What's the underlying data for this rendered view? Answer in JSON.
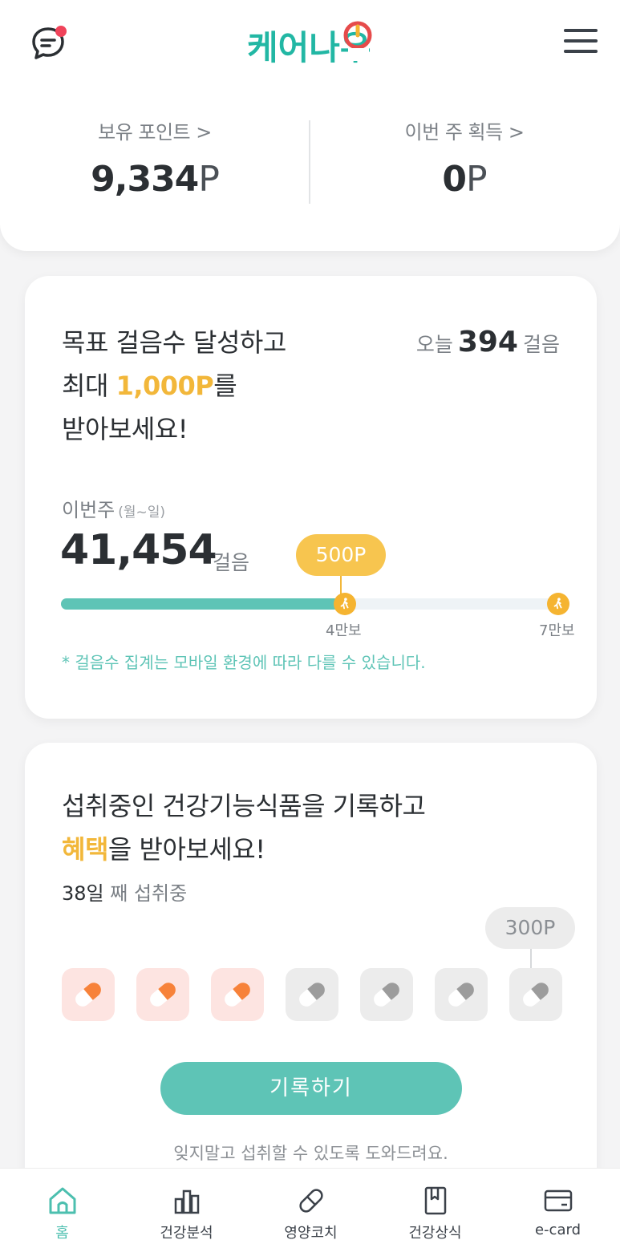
{
  "header": {
    "logo": "케어나우",
    "icons": {
      "chat": "chat-notification-icon",
      "menu": "hamburger-menu-icon"
    },
    "notification_dot_color": "#f0435a"
  },
  "points": {
    "held": {
      "label": "보유 포인트 >",
      "value": "9,334",
      "unit": "P"
    },
    "weekly": {
      "label": "이번 주 획득 >",
      "value": "0",
      "unit": "P"
    }
  },
  "steps_card": {
    "title_line1": "목표 걸음수 달성하고",
    "title_line2_prefix": "최대 ",
    "title_line2_accent": "1,000P",
    "title_line2_suffix": "를",
    "title_line3": "받아보세요!",
    "today_prefix": "오늘",
    "today_value": "394",
    "today_suffix": "걸음",
    "week_label": "이번주",
    "week_range": "(월~일)",
    "week_steps": "41,454",
    "week_unit": "걸음",
    "reward_bubble": "500P",
    "progress_fraction": 0.592,
    "milestones": [
      {
        "label": "4만보",
        "fraction": 0.571
      },
      {
        "label": "7만보",
        "fraction": 1.0
      }
    ],
    "note": "* 걸음수 집계는 모바일 환경에 따라 다를 수 있습니다."
  },
  "supplement_card": {
    "title_line1": "섭취중인 건강기능식품을 기록하고",
    "title_line2_accent": "혜택",
    "title_line2_suffix": "을 받아보세요!",
    "days_num": "38일",
    "days_suffix": " 째 섭취중",
    "reward_bubble": "300P",
    "pills_taken": 3,
    "pills_total": 7,
    "record_button": "기록하기",
    "helper": "잊지말고 섭취할 수 있도록 도와드려요."
  },
  "bottom_nav": [
    {
      "label": "홈",
      "icon": "home-icon",
      "active": true
    },
    {
      "label": "건강분석",
      "icon": "bar-chart-icon",
      "active": false
    },
    {
      "label": "영양코치",
      "icon": "pill-icon",
      "active": false
    },
    {
      "label": "건강상식",
      "icon": "bookmark-book-icon",
      "active": false
    },
    {
      "label": "e-card",
      "icon": "card-icon",
      "active": false
    }
  ],
  "colors": {
    "teal": "#5ec4b6",
    "orange": "#f5b431",
    "pill_on_bg": "#fde4e1",
    "pill_off_bg": "#ececec"
  }
}
